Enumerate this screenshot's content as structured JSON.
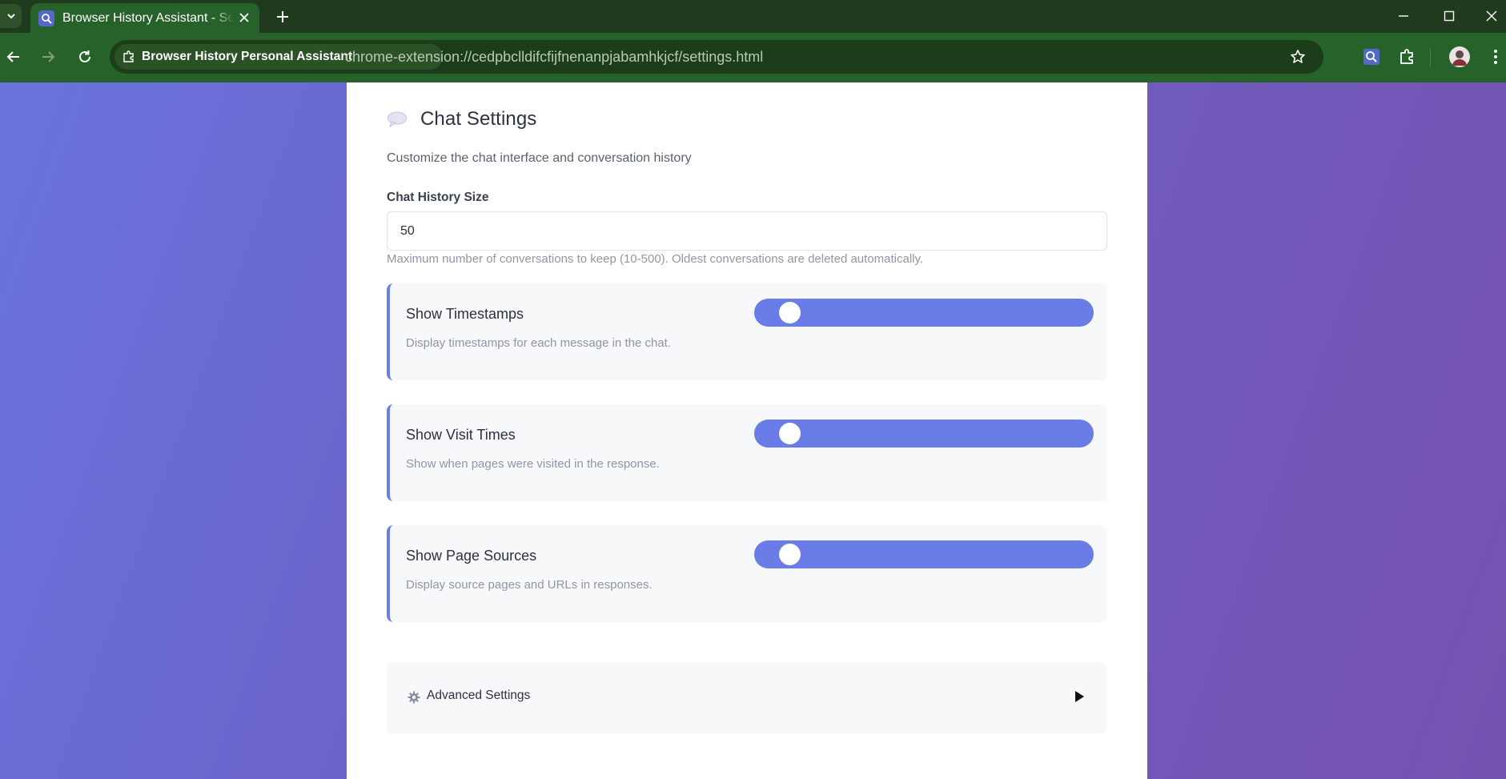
{
  "browser": {
    "tab": {
      "title": "Browser History Assistant - Settings"
    },
    "address_bar": {
      "site_chip": "Browser History Personal Assistant",
      "url": "chrome-extension://cedpbclldifcfijfnenanpjabamhkjcf/settings.html"
    },
    "icons": {
      "tab_search": "chevron-down-icon",
      "favicon": "magnifier-icon",
      "close_tab": "close-icon",
      "new_tab": "plus-icon",
      "back": "arrow-left-icon",
      "forward": "arrow-right-icon",
      "reload": "reload-icon",
      "extension_chip": "puzzle-icon",
      "bookmark": "star-icon",
      "extension_action": "magnifier-icon",
      "extensions_menu": "puzzle-icon",
      "profile": "avatar",
      "menu": "kebab-icon"
    }
  },
  "colors": {
    "browser_frame": "#1f3a1d",
    "toolbar": "#27622a",
    "accent": "#6a7de7",
    "background_gradient_start": "#6873dc",
    "background_gradient_end": "#7452b0"
  },
  "chat_settings": {
    "icon": "speech-bubble-icon",
    "title": "Chat Settings",
    "description": "Customize the chat interface and conversation history",
    "history_size": {
      "label": "Chat History Size",
      "value": "50",
      "help": "Maximum number of conversations to keep (10-500). Oldest conversations are deleted automatically."
    },
    "toggles": [
      {
        "title": "Show Timestamps",
        "description": "Display timestamps for each message in the chat."
      },
      {
        "title": "Show Visit Times",
        "description": "Show when pages were visited in the response."
      },
      {
        "title": "Show Page Sources",
        "description": "Display source pages and URLs in responses."
      }
    ]
  },
  "advanced_settings": {
    "icon": "gear-icon",
    "label": "Advanced Settings",
    "expand_icon": "triangle-right-icon"
  }
}
